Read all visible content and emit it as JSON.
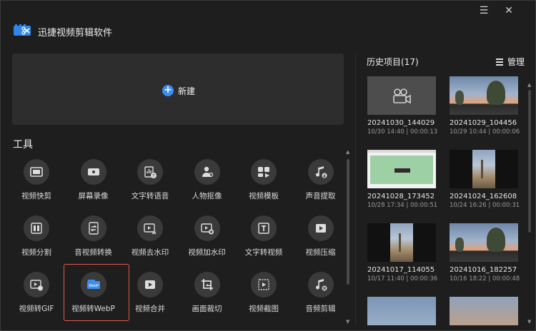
{
  "app": {
    "title": "迅捷视频剪辑软件"
  },
  "window": {
    "minimize_icon": "menu-icon",
    "close_icon": "close-icon"
  },
  "new_project": {
    "label": "新建",
    "accent": "#3b8ef0"
  },
  "tools": {
    "title": "工具",
    "items": [
      {
        "label": "视频快剪",
        "icon": "film-icon"
      },
      {
        "label": "屏幕录像",
        "icon": "screen-record-icon"
      },
      {
        "label": "文字转语音",
        "icon": "text-to-speech-icon"
      },
      {
        "label": "人物抠像",
        "icon": "person-cutout-icon"
      },
      {
        "label": "视频模板",
        "icon": "template-icon"
      },
      {
        "label": "声音提取",
        "icon": "music-extract-icon"
      },
      {
        "label": "视频分割",
        "icon": "split-icon"
      },
      {
        "label": "音视频转换",
        "icon": "convert-icon"
      },
      {
        "label": "视频去水印",
        "icon": "remove-watermark-icon"
      },
      {
        "label": "视频加水印",
        "icon": "add-watermark-icon"
      },
      {
        "label": "文字转视频",
        "icon": "text-to-video-icon"
      },
      {
        "label": "视频压缩",
        "icon": "compress-icon"
      },
      {
        "label": "视频转GIF",
        "icon": "gif-icon"
      },
      {
        "label": "视频转WebP",
        "icon": "webp-icon"
      },
      {
        "label": "视频合并",
        "icon": "merge-icon"
      },
      {
        "label": "画面裁切",
        "icon": "crop-icon"
      },
      {
        "label": "视频截图",
        "icon": "screenshot-icon"
      },
      {
        "label": "音频剪辑",
        "icon": "audio-edit-icon"
      }
    ],
    "selected_label": "视频转WebP",
    "selected_color": "#e35a4b"
  },
  "history": {
    "title": "历史项目(17)",
    "manage_label": "管理",
    "items": [
      {
        "name": "20241030_144029",
        "meta": "10/30 14:40 | 00:00:13",
        "thumb": "placeholder"
      },
      {
        "name": "20241029_104456",
        "meta": "10/29 10:44 | 00:00:06",
        "thumb": "sunset"
      },
      {
        "name": "20241028_173452",
        "meta": "10/28 17:34 | 00:00:51",
        "thumb": "screen"
      },
      {
        "name": "20241024_162608",
        "meta": "10/24 16:26 | 00:00:31",
        "thumb": "portrait"
      },
      {
        "name": "20241017_114055",
        "meta": "10/17 11:40 | 00:00:36",
        "thumb": "portrait"
      },
      {
        "name": "20241016_182257",
        "meta": "10/16 18:22 | 00:00:48",
        "thumb": "sunset"
      }
    ]
  }
}
